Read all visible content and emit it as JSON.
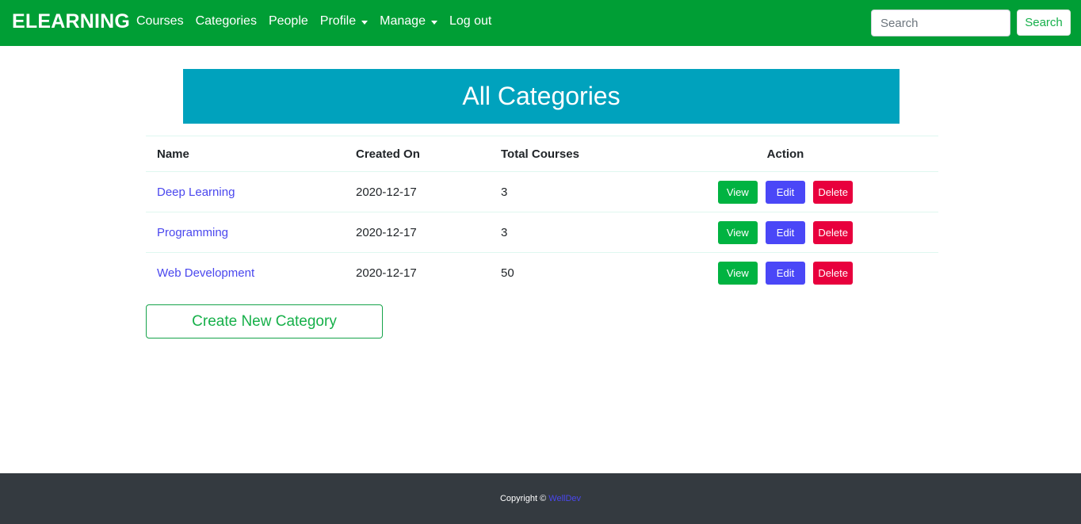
{
  "navbar": {
    "brand": "ELEARNING",
    "links": [
      "Courses",
      "Categories",
      "People",
      "Profile",
      "Manage",
      "Log out"
    ],
    "search_placeholder": "Search",
    "search_button": "Search",
    "color": "#009e35"
  },
  "banner": {
    "title": "All Categories",
    "color": "#00a2bd"
  },
  "table": {
    "headers": [
      "Name",
      "Created On",
      "Total Courses",
      "Action"
    ],
    "rows": [
      {
        "name": "Deep Learning",
        "created_on": "2020-12-17",
        "total_courses": "3"
      },
      {
        "name": "Programming",
        "created_on": "2020-12-17",
        "total_courses": "3"
      },
      {
        "name": "Web Development",
        "created_on": "2020-12-17",
        "total_courses": "50"
      }
    ],
    "actions": {
      "view": "View",
      "edit": "Edit",
      "delete": "Delete"
    }
  },
  "create_button": "Create New Category",
  "footer": {
    "copyright": "Copyright ©",
    "owner": "WellDev"
  }
}
